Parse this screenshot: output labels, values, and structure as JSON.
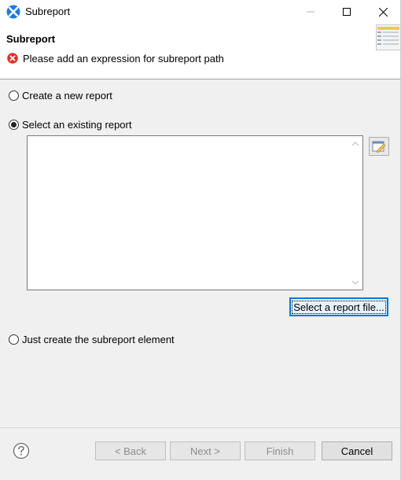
{
  "window": {
    "title": "Subreport"
  },
  "header": {
    "title": "Subreport",
    "message": "Please add an expression for subreport path",
    "message_icon": "error-icon",
    "banner_icon": "wizard-report-icon"
  },
  "options": [
    {
      "label": "Create a new report",
      "selected": false
    },
    {
      "label": "Select an existing report",
      "selected": true
    },
    {
      "label": "Just create the subreport element",
      "selected": false
    }
  ],
  "expression": {
    "value": "",
    "button_icon": "expression-editor-icon"
  },
  "select_file_button": "Select a report file...",
  "footer": {
    "help_icon": "help-icon",
    "back": "< Back",
    "next": "Next >",
    "finish": "Finish",
    "cancel": "Cancel"
  },
  "colors": {
    "focus_border": "#0078d7",
    "error_red": "#d9342b",
    "dialog_bg": "#f0f0f0"
  }
}
